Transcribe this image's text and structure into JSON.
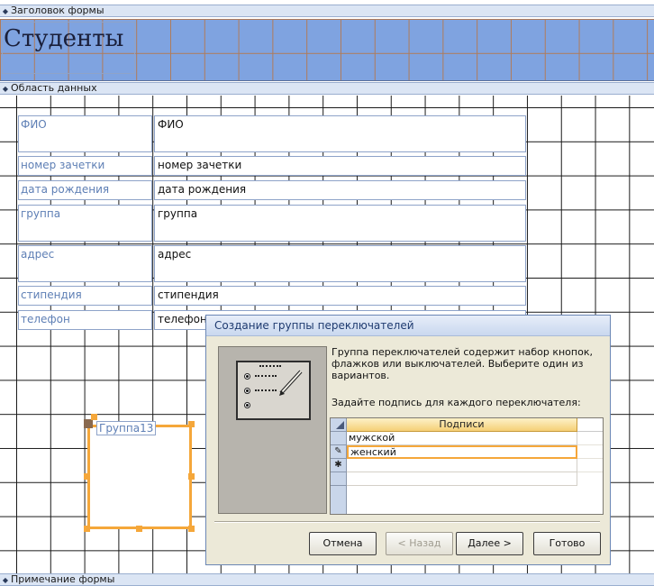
{
  "sections": {
    "form_header": "Заголовок формы",
    "detail": "Область данных",
    "form_footer": "Примечание формы"
  },
  "form": {
    "title": "Студенты",
    "fields": [
      {
        "label": "ФИО",
        "value": "ФИО"
      },
      {
        "label": "номер зачетки",
        "value": "номер зачетки"
      },
      {
        "label": "дата рождения",
        "value": "дата рождения"
      },
      {
        "label": "группа",
        "value": "группа"
      },
      {
        "label": "адрес",
        "value": "адрес"
      },
      {
        "label": "стипендия",
        "value": "стипендия"
      },
      {
        "label": "телефон",
        "value": "телефон"
      }
    ],
    "group_label": "Группа13"
  },
  "dialog": {
    "title": "Создание группы переключателей",
    "description": "Группа переключателей содержит набор кнопок, флажков или выключателей. Выберите один из вариантов.",
    "prompt": "Задайте подпись для каждого переключателя:",
    "grid_header": "Подписи",
    "rows": [
      "мужской",
      "женский"
    ],
    "row_markers": [
      "",
      "✎",
      "✱"
    ],
    "buttons": {
      "cancel": "Отмена",
      "back": "< Назад",
      "next": "Далее >",
      "finish": "Готово"
    }
  },
  "colors": {
    "header_fill": "#7fa3e0",
    "selection": "#f5a73a",
    "label_text": "#5e7fb5"
  }
}
